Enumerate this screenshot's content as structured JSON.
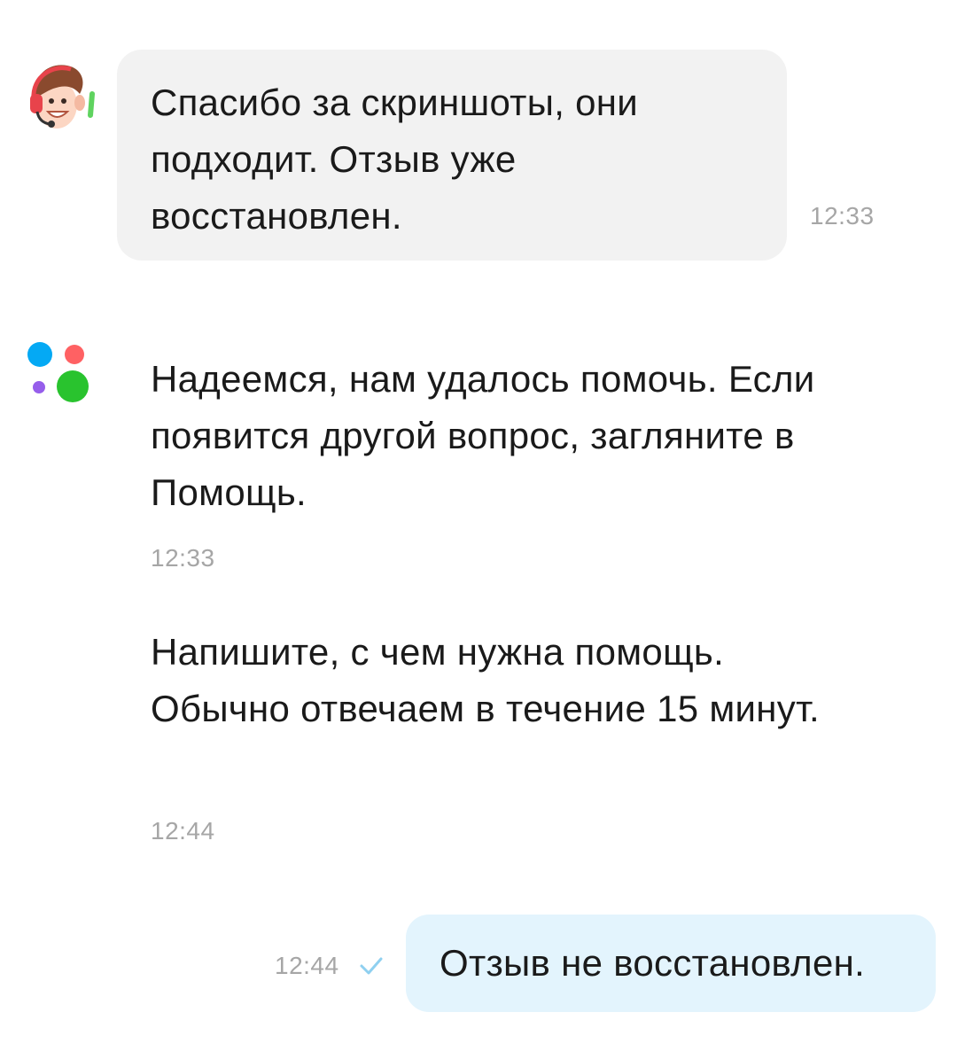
{
  "messages": [
    {
      "sender": "agent",
      "avatar": "support-agent-avatar-icon",
      "text": "Спасибо за скриншоты, они подходит. Отзыв уже восстановлен.",
      "time": "12:33"
    },
    {
      "sender": "brand",
      "avatar": "brand-dots-logo-icon",
      "text": "Надеемся, нам удалось помочь. Если появится другой вопрос, загляните в Помощь.",
      "time": "12:33"
    },
    {
      "sender": "brand",
      "text": "Напишите, с чем нужна помощь. Обычно отвечаем в течение 15 минут.",
      "time": "12:44"
    },
    {
      "sender": "user",
      "text": "Отзыв не восстановлен.",
      "time": "12:44",
      "status": "check-icon"
    }
  ],
  "colors": {
    "incoming_bubble": "#f2f2f2",
    "outgoing_bubble": "#e3f4fd",
    "timestamp": "#a6a6a6",
    "check": "#8fd0f0",
    "logo_blue": "#04a9f4",
    "logo_red": "#ff6163",
    "logo_purple": "#965eeb",
    "logo_green": "#29c32e"
  }
}
